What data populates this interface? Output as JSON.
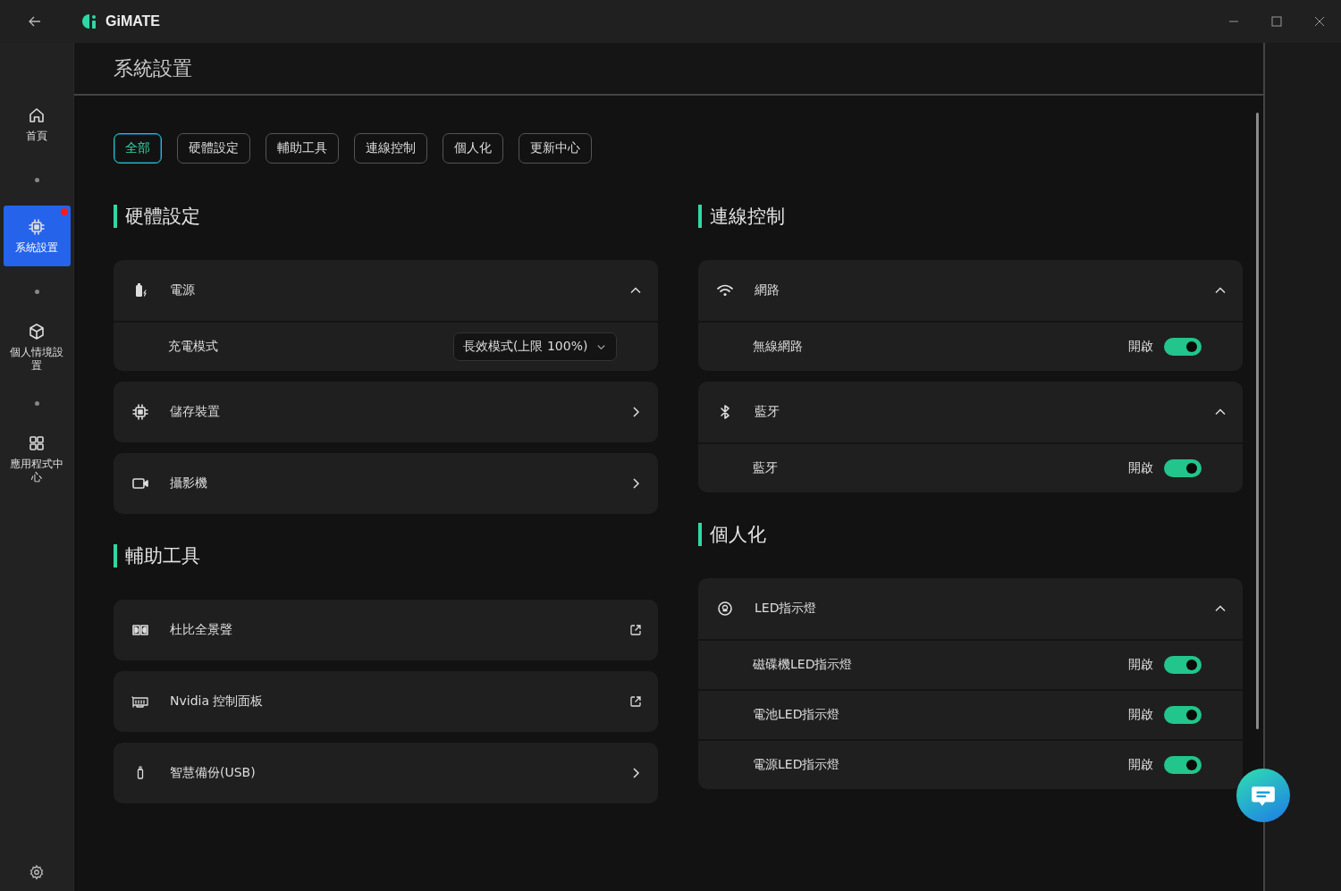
{
  "app": {
    "title": "GiMATE"
  },
  "sidebar": {
    "items": [
      {
        "label": "首頁",
        "selected": false,
        "badge": false
      },
      {
        "label": "系統設置",
        "selected": true,
        "badge": true
      },
      {
        "label": "個人情境設置",
        "selected": false,
        "badge": false
      },
      {
        "label": "應用程式中心",
        "selected": false,
        "badge": false
      }
    ]
  },
  "page": {
    "title": "系統設置"
  },
  "filters": [
    {
      "label": "全部",
      "selected": true
    },
    {
      "label": "硬體設定",
      "selected": false
    },
    {
      "label": "輔助工具",
      "selected": false
    },
    {
      "label": "連線控制",
      "selected": false
    },
    {
      "label": "個人化",
      "selected": false
    },
    {
      "label": "更新中心",
      "selected": false
    }
  ],
  "columns": [
    {
      "sections": [
        {
          "title": "硬體設定",
          "groups": [
            {
              "label": "電源",
              "kind": "collapsible",
              "expanded": true,
              "rows": [
                {
                  "kind": "select",
                  "label": "充電模式",
                  "value": "長效模式(上限 100%)"
                }
              ]
            },
            {
              "label": "儲存裝置",
              "kind": "link"
            },
            {
              "label": "攝影機",
              "kind": "link"
            }
          ]
        },
        {
          "title": "輔助工具",
          "groups": [
            {
              "label": "杜比全景聲",
              "kind": "external"
            },
            {
              "label": "Nvidia 控制面板",
              "kind": "external"
            },
            {
              "label": "智慧備份(USB)",
              "kind": "link"
            }
          ]
        }
      ]
    },
    {
      "sections": [
        {
          "title": "連線控制",
          "groups": [
            {
              "label": "網路",
              "kind": "collapsible",
              "expanded": true,
              "rows": [
                {
                  "kind": "toggle",
                  "label": "無線網路",
                  "state_text": "開啟",
                  "on": true
                }
              ]
            },
            {
              "label": "藍牙",
              "kind": "collapsible",
              "expanded": true,
              "rows": [
                {
                  "kind": "toggle",
                  "label": "藍牙",
                  "state_text": "開啟",
                  "on": true
                }
              ]
            }
          ]
        },
        {
          "title": "個人化",
          "groups": [
            {
              "label": "LED指示燈",
              "kind": "collapsible",
              "expanded": true,
              "rows": [
                {
                  "kind": "toggle",
                  "label": "磁碟機LED指示燈",
                  "state_text": "開啟",
                  "on": true
                },
                {
                  "kind": "toggle",
                  "label": "電池LED指示燈",
                  "state_text": "開啟",
                  "on": true
                },
                {
                  "kind": "toggle",
                  "label": "電源LED指示燈",
                  "state_text": "開啟",
                  "on": true
                }
              ]
            }
          ]
        }
      ]
    }
  ]
}
